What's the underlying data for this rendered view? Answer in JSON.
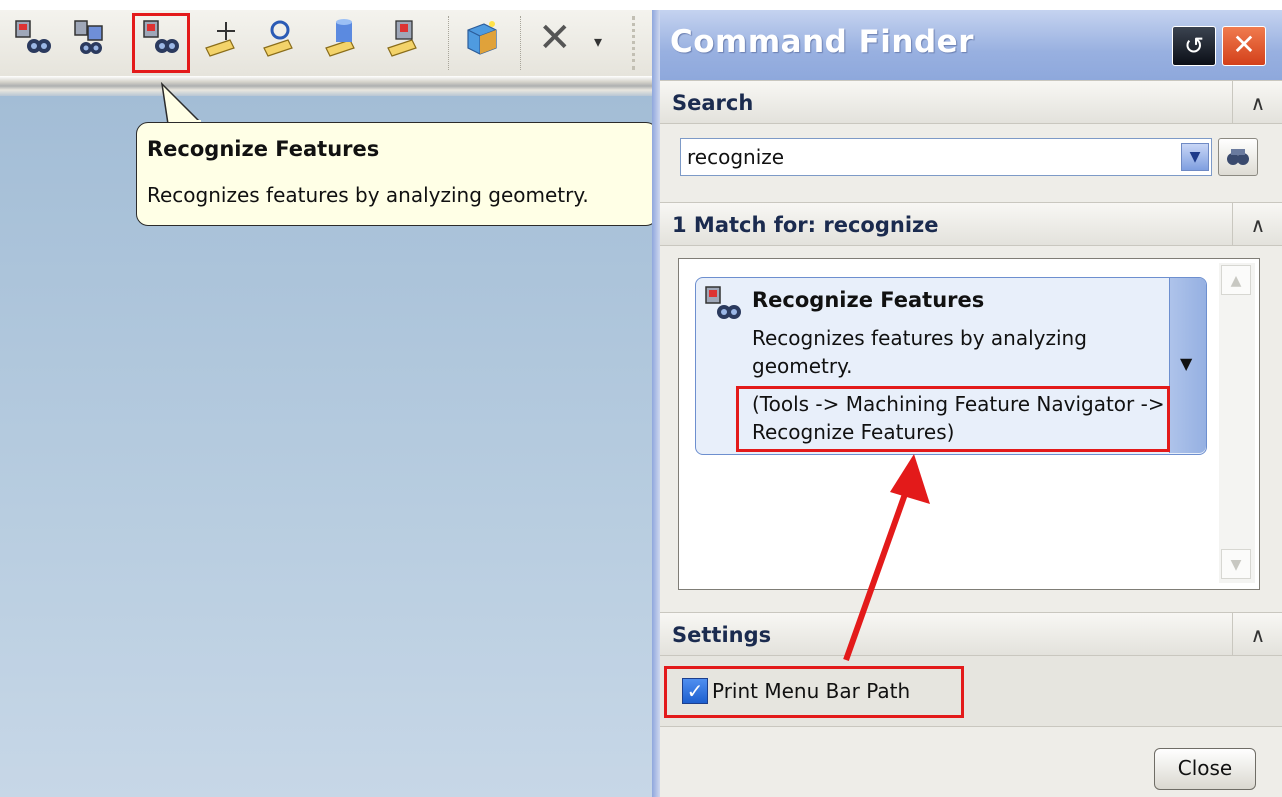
{
  "tooltip": {
    "title": "Recognize Features",
    "description": "Recognizes features by analyzing geometry."
  },
  "command_finder": {
    "title": "Command Finder",
    "search_section": {
      "label": "Search",
      "query": "recognize"
    },
    "results_section": {
      "label": "1 Match for: recognize",
      "result": {
        "title": "Recognize Features",
        "description": "Recognizes features by analyzing geometry.",
        "menu_path": "(Tools -> Machining Feature Navigator -> Recognize Features)"
      }
    },
    "settings_section": {
      "label": "Settings",
      "print_menu_bar_path_label": "Print Menu Bar Path",
      "print_menu_bar_path_checked": true
    },
    "close_button_label": "Close"
  },
  "toolbar": {
    "icons": [
      "feature-navigator-icon",
      "feature-compare-icon",
      "recognize-features-icon",
      "add-feature-icon",
      "search-feature-icon",
      "cylinder-feature-icon",
      "feature-group-icon",
      "cube-feature-icon",
      "delete-icon"
    ]
  },
  "colors": {
    "annotation_red": "#e31a1a",
    "panel_title_blue": "#98b0e0",
    "tooltip_bg": "#ffffe6"
  }
}
